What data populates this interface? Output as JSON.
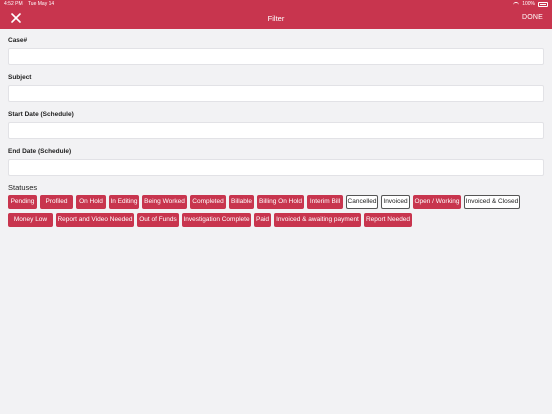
{
  "status_bar": {
    "time": "4:52 PM",
    "date": "Tue May 14",
    "battery": "100%"
  },
  "header": {
    "title": "Filter",
    "done_label": "DONE"
  },
  "fields": [
    {
      "label": "Case#",
      "value": ""
    },
    {
      "label": "Subject",
      "value": ""
    },
    {
      "label": "Start Date (Schedule)",
      "value": ""
    },
    {
      "label": "End Date (Schedule)",
      "value": ""
    }
  ],
  "statuses_label": "Statuses",
  "statuses": [
    {
      "label": "Pending",
      "selected": true
    },
    {
      "label": "Profiled",
      "selected": true
    },
    {
      "label": "On Hold",
      "selected": true
    },
    {
      "label": "In Editing",
      "selected": true
    },
    {
      "label": "Being Worked",
      "selected": true
    },
    {
      "label": "Completed",
      "selected": true
    },
    {
      "label": "Billable",
      "selected": true
    },
    {
      "label": "Billing On Hold",
      "selected": true
    },
    {
      "label": "Interim Bill",
      "selected": true
    },
    {
      "label": "Cancelled",
      "selected": false
    },
    {
      "label": "Invoiced",
      "selected": false
    },
    {
      "label": "Open / Working",
      "selected": true
    },
    {
      "label": "Invoiced & Closed",
      "selected": false
    },
    {
      "label": "Money Low",
      "selected": true
    },
    {
      "label": "Report and Video Needed",
      "selected": true
    },
    {
      "label": "Out of Funds",
      "selected": true
    },
    {
      "label": "Investigation Complete",
      "selected": true
    },
    {
      "label": "Paid",
      "selected": true
    },
    {
      "label": "Invoiced & awaiting payment",
      "selected": true
    },
    {
      "label": "Report Needed",
      "selected": true
    }
  ],
  "colors": {
    "accent": "#c8354e",
    "background": "#f2f2f4"
  }
}
